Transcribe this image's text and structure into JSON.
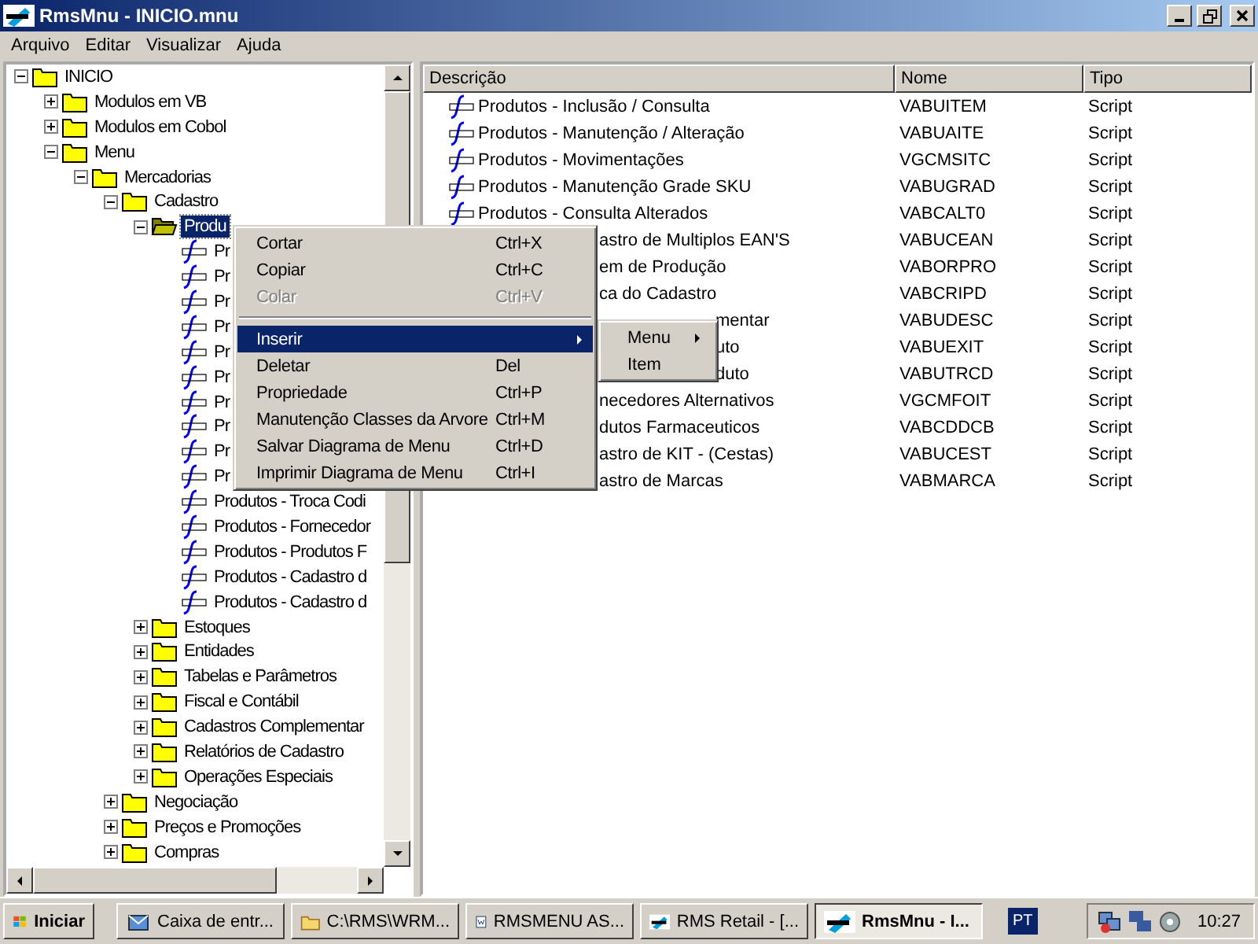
{
  "window": {
    "title": "RmsMnu - INICIO.mnu"
  },
  "menu_bar": [
    "Arquivo",
    "Editar",
    "Visualizar",
    "Ajuda"
  ],
  "tree": [
    {
      "label": "INICIO",
      "kind": "folder",
      "expanded": true,
      "selected": false,
      "children": [
        {
          "label": "Modulos em VB",
          "kind": "folder",
          "expanded": false,
          "selected": false
        },
        {
          "label": "Modulos em Cobol",
          "kind": "folder",
          "expanded": false,
          "selected": false
        },
        {
          "label": "Menu",
          "kind": "folder",
          "expanded": true,
          "selected": false,
          "children": [
            {
              "label": "Mercadorias",
              "kind": "folder",
              "expanded": true,
              "selected": false,
              "children": [
                {
                  "label": "Cadastro",
                  "kind": "folder",
                  "expanded": true,
                  "selected": false,
                  "children": [
                    {
                      "label": "Produ",
                      "kind": "folder",
                      "expanded": true,
                      "selected": true,
                      "children": [
                        {
                          "label": "Pr",
                          "kind": "script",
                          "selected": false
                        },
                        {
                          "label": "Pr",
                          "kind": "script",
                          "selected": false
                        },
                        {
                          "label": "Pr",
                          "kind": "script",
                          "selected": false
                        },
                        {
                          "label": "Pr",
                          "kind": "script",
                          "selected": false
                        },
                        {
                          "label": "Pr",
                          "kind": "script",
                          "selected": false
                        },
                        {
                          "label": "Pr",
                          "kind": "script",
                          "selected": false
                        },
                        {
                          "label": "Pr",
                          "kind": "script",
                          "selected": false
                        },
                        {
                          "label": "Pr",
                          "kind": "script",
                          "selected": false
                        },
                        {
                          "label": "Pr",
                          "kind": "script",
                          "selected": false
                        },
                        {
                          "label": "Pr",
                          "kind": "script",
                          "selected": false
                        },
                        {
                          "label": "Produtos - Troca Codi",
                          "kind": "script",
                          "selected": false
                        },
                        {
                          "label": "Produtos - Fornecedor",
                          "kind": "script",
                          "selected": false
                        },
                        {
                          "label": "Produtos - Produtos F",
                          "kind": "script",
                          "selected": false
                        },
                        {
                          "label": "Produtos - Cadastro d",
                          "kind": "script",
                          "selected": false
                        },
                        {
                          "label": "Produtos - Cadastro d",
                          "kind": "script",
                          "selected": false
                        }
                      ]
                    },
                    {
                      "label": "Estoques",
                      "kind": "folder",
                      "expanded": false,
                      "selected": false
                    },
                    {
                      "label": "Entidades",
                      "kind": "folder",
                      "expanded": false,
                      "selected": false
                    },
                    {
                      "label": "Tabelas e Parâmetros",
                      "kind": "folder",
                      "expanded": false,
                      "selected": false
                    },
                    {
                      "label": "Fiscal e Contábil",
                      "kind": "folder",
                      "expanded": false,
                      "selected": false
                    },
                    {
                      "label": "Cadastros Complementar",
                      "kind": "folder",
                      "expanded": false,
                      "selected": false
                    },
                    {
                      "label": "Relatórios de Cadastro",
                      "kind": "folder",
                      "expanded": false,
                      "selected": false
                    },
                    {
                      "label": "Operações Especiais",
                      "kind": "folder",
                      "expanded": false,
                      "selected": false
                    }
                  ]
                },
                {
                  "label": "Negociação",
                  "kind": "folder",
                  "expanded": false,
                  "selected": false
                },
                {
                  "label": "Preços e Promoções",
                  "kind": "folder",
                  "expanded": false,
                  "selected": false
                },
                {
                  "label": "Compras",
                  "kind": "folder",
                  "expanded": false,
                  "selected": false
                }
              ]
            }
          ]
        }
      ]
    }
  ],
  "table": {
    "columns": [
      "Descrição",
      "Nome",
      "Tipo"
    ],
    "rows": [
      {
        "kind": "full",
        "description": "Produtos - Inclusão / Consulta",
        "name": "VABUITEM",
        "type": "Script"
      },
      {
        "kind": "full",
        "description": "Produtos - Manutenção / Alteração",
        "name": "VABUAITE",
        "type": "Script"
      },
      {
        "kind": "full",
        "description": "Produtos - Movimentações",
        "name": "VGCMSITC",
        "type": "Script"
      },
      {
        "kind": "full",
        "description": "Produtos - Manutenção Grade SKU",
        "name": "VABUGRAD",
        "type": "Script"
      },
      {
        "kind": "full",
        "description": "Produtos - Consulta Alterados",
        "name": "VABCALT0",
        "type": "Script"
      },
      {
        "kind": "covered",
        "description": "astro de Multiplos EAN'S",
        "name": "VABUCEAN",
        "type": "Script"
      },
      {
        "kind": "covered",
        "description": "em de Produção",
        "name": "VABORPRO",
        "type": "Script"
      },
      {
        "kind": "covered",
        "description": "ca do Cadastro",
        "name": "VABCRIPD",
        "type": "Script"
      },
      {
        "kind": "submenu",
        "description": "mentar",
        "name": "VABUDESC",
        "type": "Script"
      },
      {
        "kind": "submenu",
        "description": "uto",
        "name": "VABUEXIT",
        "type": "Script"
      },
      {
        "kind": "submenu",
        "description": "duto",
        "name": "VABUTRCD",
        "type": "Script"
      },
      {
        "kind": "covered",
        "description": "necedores Alternativos",
        "name": "VGCMFOIT",
        "type": "Script"
      },
      {
        "kind": "covered",
        "description": "dutos Farmaceuticos",
        "name": "VABCDDCB",
        "type": "Script"
      },
      {
        "kind": "covered",
        "description": "astro de KIT - (Cestas)",
        "name": "VABUCEST",
        "type": "Script"
      },
      {
        "kind": "covered",
        "description": "astro de Marcas",
        "name": "VABMARCA",
        "type": "Script"
      }
    ]
  },
  "context_menu": {
    "items": [
      {
        "kind": "item",
        "label": "Cortar",
        "shortcut": "Ctrl+X",
        "disabled": false,
        "selected": false
      },
      {
        "kind": "item",
        "label": "Copiar",
        "shortcut": "Ctrl+C",
        "disabled": false,
        "selected": false
      },
      {
        "kind": "item",
        "label": "Colar",
        "shortcut": "Ctrl+V",
        "disabled": true,
        "selected": false
      },
      {
        "kind": "separator"
      },
      {
        "kind": "submenu",
        "label": "Inserir",
        "disabled": false,
        "selected": true
      },
      {
        "kind": "item",
        "label": "Deletar",
        "shortcut": "Del",
        "disabled": false,
        "selected": false
      },
      {
        "kind": "item",
        "label": "Propriedade",
        "shortcut": "Ctrl+P",
        "disabled": false,
        "selected": false
      },
      {
        "kind": "item",
        "label": "Manutenção Classes da Arvore",
        "shortcut": "Ctrl+M",
        "disabled": false,
        "selected": false
      },
      {
        "kind": "item",
        "label": "Salvar Diagrama de Menu",
        "shortcut": "Ctrl+D",
        "disabled": false,
        "selected": false
      },
      {
        "kind": "item",
        "label": "Imprimir Diagrama de Menu",
        "shortcut": "Ctrl+I",
        "disabled": false,
        "selected": false
      }
    ],
    "submenu": [
      {
        "kind": "submenu",
        "label": "Menu"
      },
      {
        "kind": "item",
        "label": "Item"
      }
    ]
  },
  "taskbar": {
    "start": "Iniciar",
    "buttons": [
      {
        "label": "Caixa de entr...",
        "kind": "mail",
        "selected": false
      },
      {
        "label": "C:\\RMS\\WRM...",
        "kind": "folder",
        "selected": false
      },
      {
        "label": "RMSMENU AS...",
        "kind": "word",
        "selected": false
      },
      {
        "label": "RMS Retail - [...",
        "kind": "app",
        "selected": false
      },
      {
        "label": "RmsMnu - I...",
        "kind": "app",
        "selected": true
      }
    ],
    "language": "PT",
    "clock": "10:27"
  }
}
